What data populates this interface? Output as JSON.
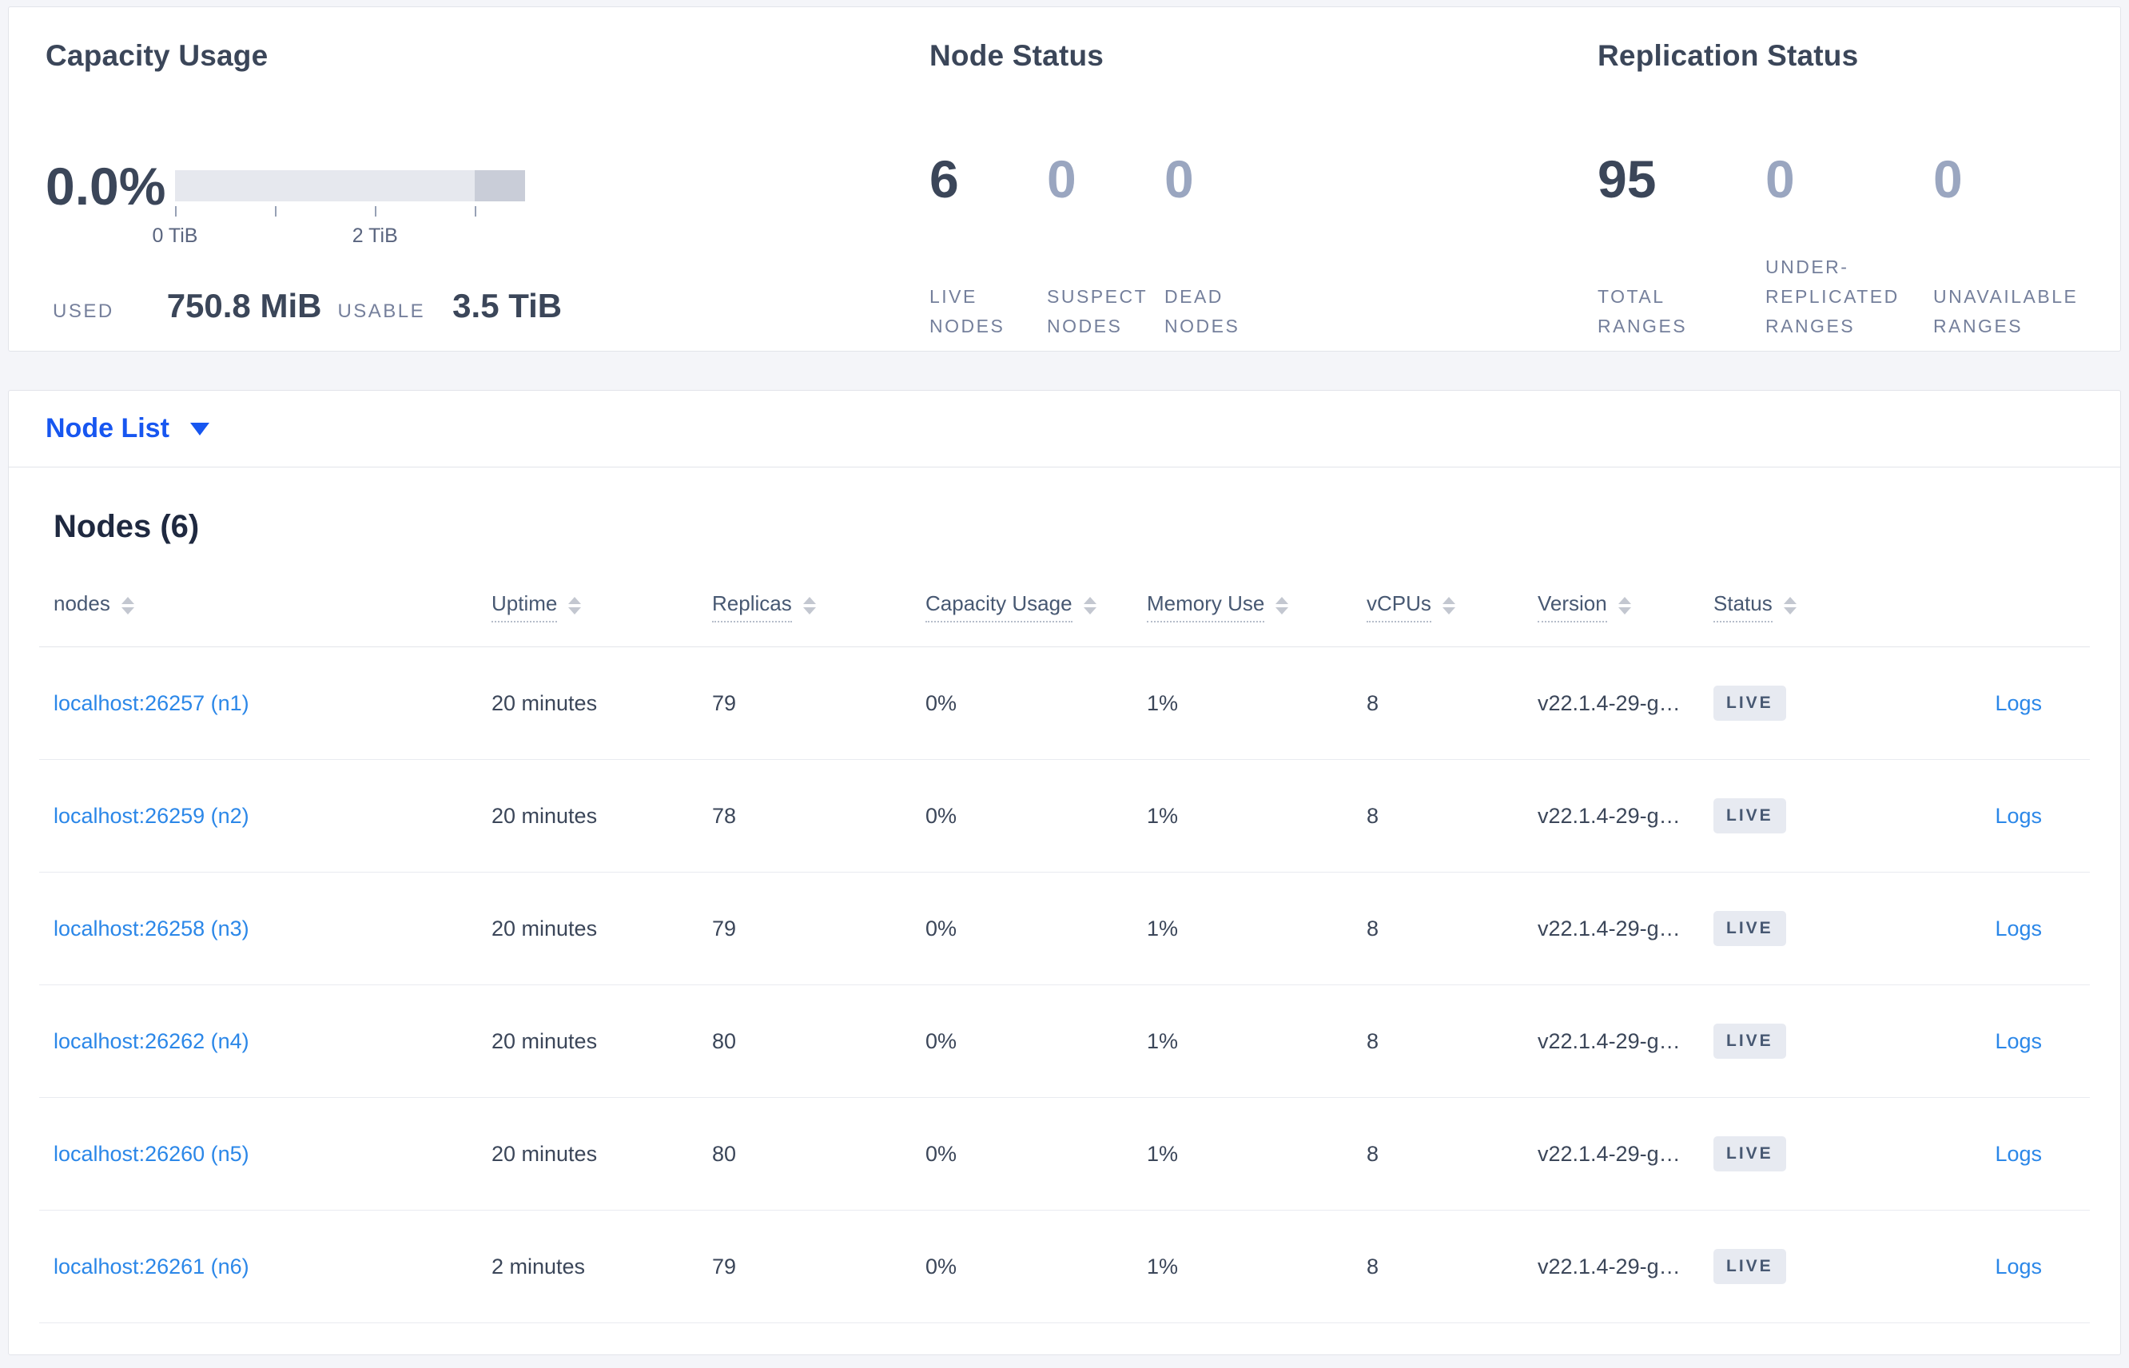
{
  "colors": {
    "page_background": "#f4f5f9",
    "heading_navy": "#3b4659",
    "muted_stat": "#9aa6c0",
    "stat_label": "#747f9b",
    "selector_blue": "#1756f0",
    "link_blue": "#2b87e8",
    "bar_light": "#e6e8ee",
    "bar_dark": "#c9cdd8",
    "badge_background": "#e7eaf1",
    "badge_text": "#475872"
  },
  "summary": {
    "capacity": {
      "title": "Capacity Usage",
      "percent": "0.0%",
      "tick_label_0": "0 TiB",
      "tick_label_2": "2 TiB",
      "used_label": "USED",
      "used_value": "750.8 MiB",
      "usable_label": "USABLE",
      "usable_value": "3.5 TiB",
      "gauge": {
        "max_tib": 3.5,
        "tick_interval_tib": 1,
        "used_fraction": 0.0,
        "segments": [
          {
            "from_fraction": 0,
            "to_fraction": 0.857,
            "color": "#e6e8ee"
          },
          {
            "from_fraction": 0.857,
            "to_fraction": 1,
            "color": "#c9cdd8"
          }
        ]
      }
    },
    "node_status": {
      "title": "Node Status",
      "stats": [
        {
          "value": "6",
          "label": "LIVE NODES",
          "emphasized": true
        },
        {
          "value": "0",
          "label": "SUSPECT NODES",
          "emphasized": false
        },
        {
          "value": "0",
          "label": "DEAD NODES",
          "emphasized": false
        }
      ]
    },
    "replication_status": {
      "title": "Replication Status",
      "stats": [
        {
          "value": "95",
          "label": "TOTAL RANGES",
          "emphasized": true
        },
        {
          "value": "0",
          "label": "UNDER-REPLICATED RANGES",
          "emphasized": false
        },
        {
          "value": "0",
          "label": "UNAVAILABLE RANGES",
          "emphasized": false
        }
      ]
    }
  },
  "view_selector": {
    "label": "Node List"
  },
  "nodes_table": {
    "title": "Nodes (6)",
    "columns": [
      {
        "label": "nodes",
        "sortable": true,
        "tooltip_underline": false
      },
      {
        "label": "Uptime",
        "sortable": true,
        "tooltip_underline": true
      },
      {
        "label": "Replicas",
        "sortable": true,
        "tooltip_underline": true
      },
      {
        "label": "Capacity Usage",
        "sortable": true,
        "tooltip_underline": true
      },
      {
        "label": "Memory Use",
        "sortable": true,
        "tooltip_underline": true
      },
      {
        "label": "vCPUs",
        "sortable": true,
        "tooltip_underline": true
      },
      {
        "label": "Version",
        "sortable": true,
        "tooltip_underline": true
      },
      {
        "label": "Status",
        "sortable": true,
        "tooltip_underline": true
      },
      {
        "label": "",
        "sortable": false,
        "tooltip_underline": false
      }
    ],
    "rows": [
      {
        "name": "localhost:26257 (n1)",
        "uptime": "20 minutes",
        "replicas": "79",
        "capacity_usage": "0%",
        "memory_use": "1%",
        "vcpus": "8",
        "version": "v22.1.4-29-g…",
        "status": "LIVE",
        "logs": "Logs"
      },
      {
        "name": "localhost:26259 (n2)",
        "uptime": "20 minutes",
        "replicas": "78",
        "capacity_usage": "0%",
        "memory_use": "1%",
        "vcpus": "8",
        "version": "v22.1.4-29-g…",
        "status": "LIVE",
        "logs": "Logs"
      },
      {
        "name": "localhost:26258 (n3)",
        "uptime": "20 minutes",
        "replicas": "79",
        "capacity_usage": "0%",
        "memory_use": "1%",
        "vcpus": "8",
        "version": "v22.1.4-29-g…",
        "status": "LIVE",
        "logs": "Logs"
      },
      {
        "name": "localhost:26262 (n4)",
        "uptime": "20 minutes",
        "replicas": "80",
        "capacity_usage": "0%",
        "memory_use": "1%",
        "vcpus": "8",
        "version": "v22.1.4-29-g…",
        "status": "LIVE",
        "logs": "Logs"
      },
      {
        "name": "localhost:26260 (n5)",
        "uptime": "20 minutes",
        "replicas": "80",
        "capacity_usage": "0%",
        "memory_use": "1%",
        "vcpus": "8",
        "version": "v22.1.4-29-g…",
        "status": "LIVE",
        "logs": "Logs"
      },
      {
        "name": "localhost:26261 (n6)",
        "uptime": "2 minutes",
        "replicas": "79",
        "capacity_usage": "0%",
        "memory_use": "1%",
        "vcpus": "8",
        "version": "v22.1.4-29-g…",
        "status": "LIVE",
        "logs": "Logs"
      }
    ]
  }
}
